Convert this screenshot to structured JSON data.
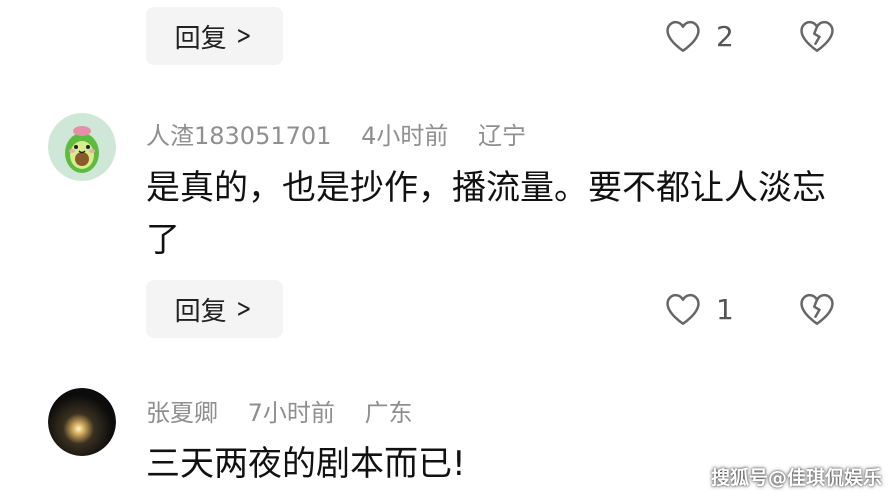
{
  "thread_top": {
    "reply_label": "回复",
    "like_count": "2"
  },
  "comments": [
    {
      "username": "人渣183051701",
      "time": "4小时前",
      "location": "辽宁",
      "text": "是真的，也是抄作，播流量。要不都让人淡忘了",
      "reply_label": "回复",
      "like_count": "1",
      "avatar": "avocado-avatar"
    },
    {
      "username": "张夏卿",
      "time": "7小时前",
      "location": "广东",
      "text": "三天两夜的剧本而已!",
      "avatar": "dark-sparkle-avatar"
    }
  ],
  "icons": {
    "like": "heart-outline-icon",
    "dislike": "broken-heart-icon",
    "chevron": "chevron-right-icon"
  },
  "watermark": "搜狐号@佳琪侃娱乐"
}
